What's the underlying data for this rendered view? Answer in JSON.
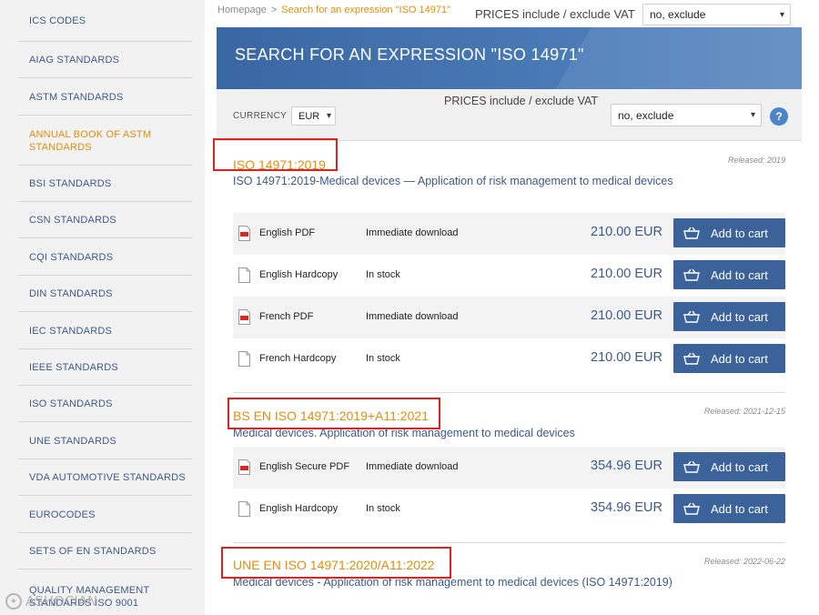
{
  "sidebar": {
    "items": [
      {
        "label": "ICS CODES",
        "active": false
      },
      {
        "label": "AIAG STANDARDS",
        "active": false
      },
      {
        "label": "ASTM STANDARDS",
        "active": false
      },
      {
        "label": "ANNUAL BOOK OF ASTM STANDARDS",
        "active": true
      },
      {
        "label": "BSI STANDARDS",
        "active": false
      },
      {
        "label": "CSN STANDARDS",
        "active": false
      },
      {
        "label": "CQI STANDARDS",
        "active": false
      },
      {
        "label": "DIN STANDARDS",
        "active": false
      },
      {
        "label": "IEC STANDARDS",
        "active": false
      },
      {
        "label": "IEEE STANDARDS",
        "active": false
      },
      {
        "label": "ISO STANDARDS",
        "active": false
      },
      {
        "label": "UNE STANDARDS",
        "active": false
      },
      {
        "label": "VDA AUTOMOTIVE STANDARDS",
        "active": false
      },
      {
        "label": "EUROCODES",
        "active": false
      },
      {
        "label": "SETS OF EN STANDARDS",
        "active": false
      },
      {
        "label": "QUALITY MANAGEMENT STANDARDS ISO 9001",
        "active": false
      }
    ],
    "watermark": "ASHOCIAN"
  },
  "breadcrumb": {
    "home": "Homepage",
    "separator": ">",
    "current": "Search for an expression \"ISO 14971\""
  },
  "vat": {
    "label": "PRICES include / exclude VAT",
    "selected": "no, exclude"
  },
  "banner": {
    "title": "SEARCH FOR AN EXPRESSION \"ISO 14971\""
  },
  "currency": {
    "label": "CURRENCY",
    "selected": "EUR"
  },
  "help_label": "?",
  "cart_label": "Add to cart",
  "products": [
    {
      "title": "ISO 14971:2019",
      "released": "Released: 2019",
      "description": "ISO 14971:2019-Medical devices — Application of risk management to medical devices",
      "rows": [
        {
          "format": "English PDF",
          "icon": "pdf-icon",
          "availability": "Immediate download",
          "price": "210.00 EUR"
        },
        {
          "format": "English Hardcopy",
          "icon": "hardcopy-icon",
          "availability": "In stock",
          "price": "210.00 EUR"
        },
        {
          "format": "French PDF",
          "icon": "pdf-icon",
          "availability": "Immediate download",
          "price": "210.00 EUR"
        },
        {
          "format": "French Hardcopy",
          "icon": "hardcopy-icon",
          "availability": "In stock",
          "price": "210.00 EUR"
        }
      ]
    },
    {
      "title": "BS EN ISO 14971:2019+A11:2021",
      "released": "Released: 2021-12-15",
      "description": "Medical devices. Application of risk management to medical devices",
      "rows": [
        {
          "format": "English Secure PDF",
          "icon": "pdf-icon",
          "availability": "Immediate download",
          "price": "354.96 EUR"
        },
        {
          "format": "English Hardcopy",
          "icon": "hardcopy-icon",
          "availability": "In stock",
          "price": "354.96 EUR"
        }
      ]
    },
    {
      "title": "UNE EN ISO 14971:2020/A11:2022",
      "released": "Released: 2022-06-22",
      "description": "Medical devices - Application of risk management to medical devices (ISO 14971:2019)",
      "rows": []
    }
  ],
  "colors": {
    "accent_orange": "#e08e0b",
    "link_blue": "#3d5a87",
    "button_blue": "#3b6299",
    "banner_blue": "#3f6ea8",
    "highlight_red": "#e0211d"
  }
}
